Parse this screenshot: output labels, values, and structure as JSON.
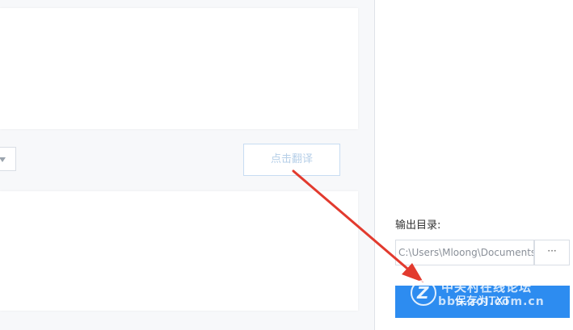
{
  "translate": {
    "button_label": "点击翻译"
  },
  "output": {
    "label": "输出目录:",
    "path_value": "C:\\Users\\Mloong\\Documents",
    "browse_label": "···",
    "save_label": "保存为TXT"
  },
  "watermark": {
    "title": "中关村在线论坛",
    "url": "bbs.zol.com.cn",
    "logo_letter": "Z"
  },
  "colors": {
    "accent": "#2d8cf0",
    "annotation_arrow": "#e23a2e"
  },
  "icons": {
    "dropdown": "chevron-down-icon",
    "browse": "ellipsis-icon"
  }
}
